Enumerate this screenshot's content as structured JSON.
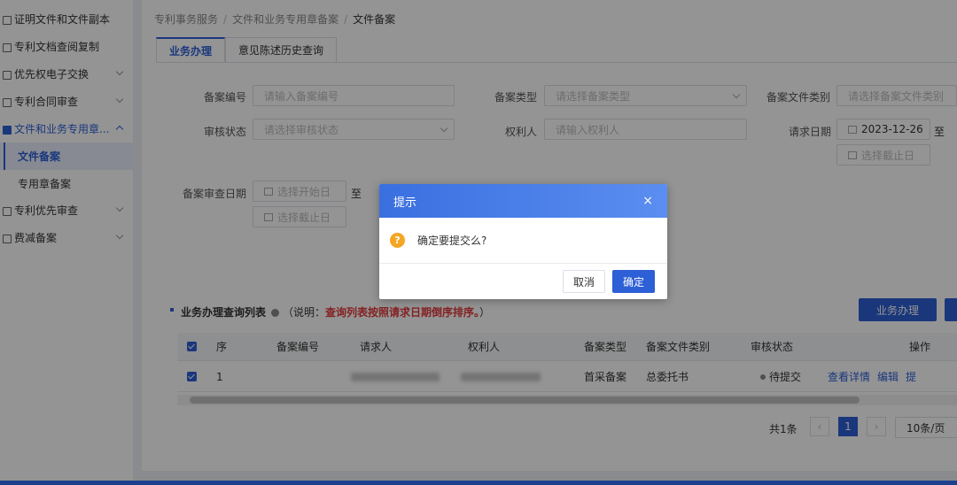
{
  "sidebar": {
    "items": [
      {
        "label": "证明文件和文件副本"
      },
      {
        "label": "专利文档查阅复制"
      },
      {
        "label": "优先权电子交换"
      },
      {
        "label": "专利合同审查"
      },
      {
        "label": "文件和业务专用章..."
      },
      {
        "label": "专利优先审查"
      },
      {
        "label": "费减备案"
      }
    ],
    "subitems": [
      {
        "label": "文件备案"
      },
      {
        "label": "专用章备案"
      }
    ]
  },
  "breadcrumb": {
    "items": [
      "专利事务服务",
      "文件和业务专用章备案",
      "文件备案"
    ],
    "sep": "/"
  },
  "tabs": [
    {
      "label": "业务办理"
    },
    {
      "label": "意见陈述历史查询"
    }
  ],
  "form": {
    "filing_no": {
      "label": "备案编号",
      "placeholder": "请输入备案编号"
    },
    "filing_type": {
      "label": "备案类型",
      "placeholder": "请选择备案类型"
    },
    "doc_type": {
      "label": "备案文件类别",
      "placeholder": "请选择备案文件类别"
    },
    "review_status": {
      "label": "审核状态",
      "placeholder": "请选择审核状态"
    },
    "right_holder": {
      "label": "权利人",
      "placeholder": "请输入权利人"
    },
    "request_date": {
      "label": "请求日期",
      "start_value": "2023-12-26",
      "end_placeholder": "选择截止日"
    },
    "review_date": {
      "label": "备案审查日期",
      "start_placeholder": "选择开始日",
      "end_placeholder": "选择截止日"
    },
    "to_label": "至"
  },
  "list": {
    "title": "业务办理查询列表",
    "note_prefix": "（说明：",
    "note_red": "查询列表按照请求日期倒序排序。",
    "note_suffix": "）",
    "action_button": "业务办理",
    "columns": [
      "序",
      "备案编号",
      "请求人",
      "权利人",
      "备案类型",
      "备案文件类别",
      "审核状态",
      "操作"
    ],
    "rows": [
      {
        "index": "1",
        "filing_no": "",
        "filing_type": "首采备案",
        "doc_type": "总委托书",
        "status": "待提交",
        "actions": [
          "查看详情",
          "编辑",
          "提"
        ]
      }
    ]
  },
  "pagination": {
    "total": "共1条",
    "current": "1",
    "page_size": "10条/页"
  },
  "dialog": {
    "title": "提示",
    "close": "×",
    "message": "确定要提交么?",
    "cancel": "取消",
    "confirm": "确定",
    "warn_glyph": "?"
  }
}
